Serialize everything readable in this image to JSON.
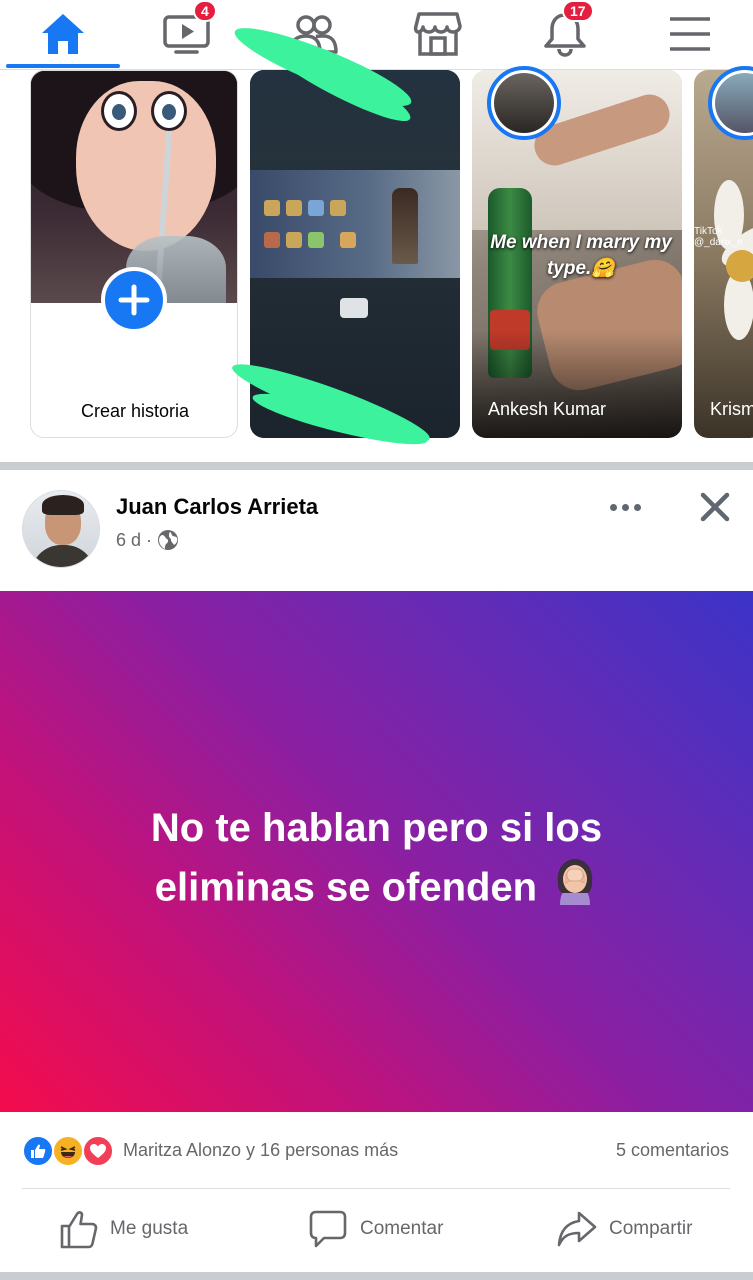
{
  "nav": {
    "items": [
      {
        "name": "home",
        "icon": "home-icon",
        "active": true
      },
      {
        "name": "watch",
        "icon": "video-icon",
        "badge": "4"
      },
      {
        "name": "friends",
        "icon": "friends-icon"
      },
      {
        "name": "marketplace",
        "icon": "store-icon"
      },
      {
        "name": "notifications",
        "icon": "bell-icon",
        "badge": "17"
      },
      {
        "name": "menu",
        "icon": "hamburger-icon"
      }
    ],
    "accent_color": "#1877f2",
    "badge_color": "#e41e3f"
  },
  "stories": {
    "create": {
      "label": "Crear historia",
      "icon": "plus-icon"
    },
    "items": [
      {
        "name": "",
        "caption": ""
      },
      {
        "name": "Ankesh Kumar",
        "caption": "Me when I marry my type.🤗"
      },
      {
        "name": "Krism",
        "caption": "",
        "watermark": "TikTok\n@_danx_e"
      }
    ]
  },
  "post": {
    "author": "Juan Carlos Arrieta",
    "time": "6 d",
    "dot": "·",
    "privacy_icon": "globe-icon",
    "text_line1": "No te hablan pero si los",
    "text_line2": "eliminas se ofenden",
    "emoji": "🤦‍♀️",
    "reactions": {
      "icons": [
        "like-icon",
        "haha-icon",
        "love-icon"
      ],
      "text": "Maritza Alonzo y 16 personas más",
      "comments": "5 comentarios"
    },
    "actions": {
      "like": "Me gusta",
      "comment": "Comentar",
      "share": "Compartir"
    }
  }
}
